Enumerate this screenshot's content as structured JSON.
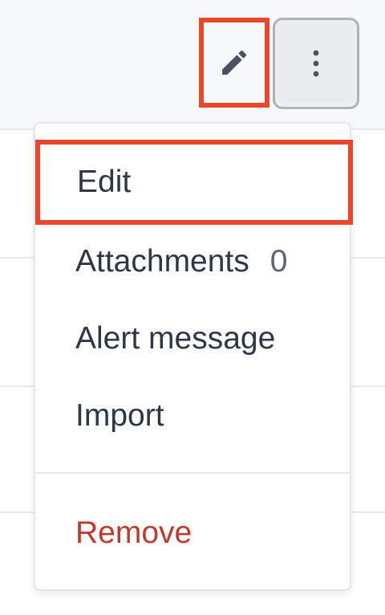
{
  "toolbar": {
    "edit_icon": "pencil-icon",
    "more_icon": "vertical-ellipsis-icon"
  },
  "menu": {
    "items": [
      {
        "label": "Edit"
      },
      {
        "label": "Attachments",
        "count": "0"
      },
      {
        "label": "Alert message"
      },
      {
        "label": "Import"
      },
      {
        "label": "Remove"
      }
    ]
  },
  "colors": {
    "highlight": "#e8472c",
    "danger": "#c0392b",
    "text": "#2d3748"
  }
}
